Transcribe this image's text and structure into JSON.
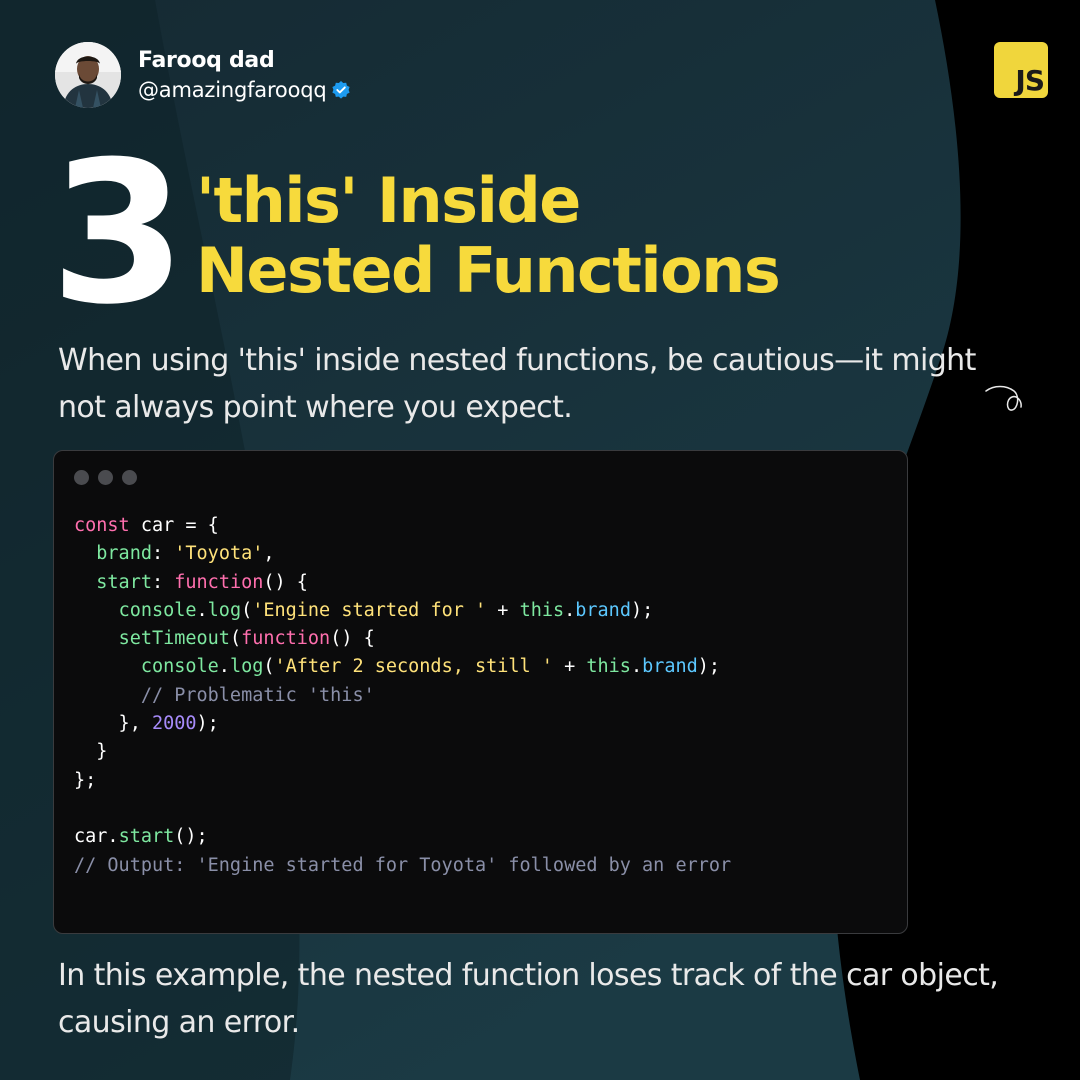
{
  "author": {
    "name": "Farooq dad",
    "handle": "@amazingfarooqq",
    "verified_icon": "verified-badge-icon"
  },
  "badge": {
    "text": "JS",
    "color": "#f0d63c"
  },
  "slide": {
    "number": "3",
    "title_lines": [
      "'this' Inside",
      "Nested Functions"
    ],
    "intro": "When using 'this' inside nested functions, be cautious—it might not always point where you expect.",
    "outro": "In this example, the nested function loses track of the car object, causing an error."
  },
  "colors": {
    "accent": "#f7da3c",
    "panel": "#0b0b0c",
    "background_teal": "#16303a",
    "keyword": "#ff6fae",
    "string": "#ffe27a",
    "property": "#7ee8a0",
    "number": "#a78bfa",
    "member": "#5cc8ff",
    "comment": "#8a8fa8"
  },
  "code": {
    "lines": [
      [
        [
          "kw",
          "const"
        ],
        [
          "id",
          " car = {"
        ]
      ],
      [
        [
          "id",
          "  "
        ],
        [
          "prop",
          "brand"
        ],
        [
          "id",
          ": "
        ],
        [
          "str",
          "'Toyota'"
        ],
        [
          "id",
          ","
        ]
      ],
      [
        [
          "id",
          "  "
        ],
        [
          "prop",
          "start"
        ],
        [
          "id",
          ": "
        ],
        [
          "kw",
          "function"
        ],
        [
          "id",
          "() {"
        ]
      ],
      [
        [
          "id",
          "    "
        ],
        [
          "fn",
          "console"
        ],
        [
          "id",
          "."
        ],
        [
          "fn",
          "log"
        ],
        [
          "id",
          "("
        ],
        [
          "str",
          "'Engine started for '"
        ],
        [
          "id",
          " + "
        ],
        [
          "fn",
          "this"
        ],
        [
          "id",
          "."
        ],
        [
          "blue",
          "brand"
        ],
        [
          "id",
          ");"
        ]
      ],
      [
        [
          "id",
          "    "
        ],
        [
          "fn",
          "setTimeout"
        ],
        [
          "id",
          "("
        ],
        [
          "kw",
          "function"
        ],
        [
          "id",
          "() {"
        ]
      ],
      [
        [
          "id",
          "      "
        ],
        [
          "fn",
          "console"
        ],
        [
          "id",
          "."
        ],
        [
          "fn",
          "log"
        ],
        [
          "id",
          "("
        ],
        [
          "str",
          "'After 2 seconds, still '"
        ],
        [
          "id",
          " + "
        ],
        [
          "fn",
          "this"
        ],
        [
          "id",
          "."
        ],
        [
          "blue",
          "brand"
        ],
        [
          "id",
          ");"
        ]
      ],
      [
        [
          "id",
          "      "
        ],
        [
          "cm",
          "// Problematic 'this'"
        ]
      ],
      [
        [
          "id",
          "    }, "
        ],
        [
          "num",
          "2000"
        ],
        [
          "id",
          ");"
        ]
      ],
      [
        [
          "id",
          "  }"
        ]
      ],
      [
        [
          "id",
          "};"
        ]
      ],
      [
        [
          "id",
          ""
        ]
      ],
      [
        [
          "id",
          "car."
        ],
        [
          "fn",
          "start"
        ],
        [
          "id",
          "();"
        ]
      ],
      [
        [
          "cm",
          "// Output: 'Engine started for Toyota' followed by an error"
        ]
      ]
    ]
  }
}
